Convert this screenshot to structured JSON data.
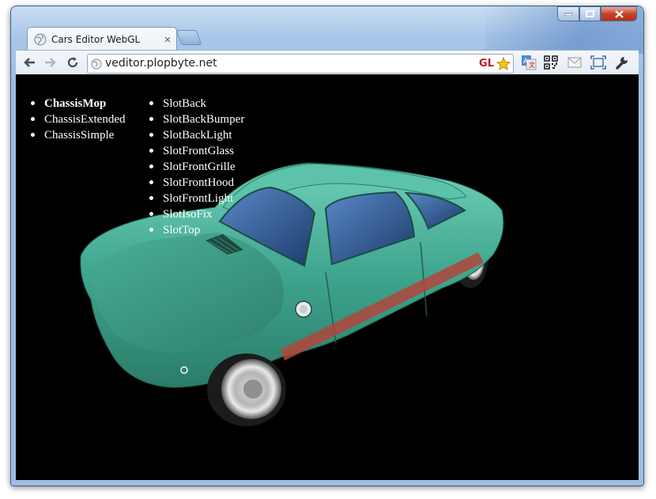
{
  "browser": {
    "tab_title": "Cars Editor WebGL",
    "url": "veditor.plopbyte.net",
    "gl_badge": "GL"
  },
  "chassis_list": [
    {
      "label": "ChassisMop",
      "selected": true
    },
    {
      "label": "ChassisExtended",
      "selected": false
    },
    {
      "label": "ChassisSimple",
      "selected": false
    }
  ],
  "slot_list": [
    {
      "label": "SlotBack"
    },
    {
      "label": "SlotBackBumper"
    },
    {
      "label": "SlotBackLight"
    },
    {
      "label": "SlotFrontGlass"
    },
    {
      "label": "SlotFrontGrille"
    },
    {
      "label": "SlotFrontHood"
    },
    {
      "label": "SlotFrontLight"
    },
    {
      "label": "SlotIsoFix"
    },
    {
      "label": "SlotTop"
    }
  ],
  "colors": {
    "car_body": "#3fa58e",
    "car_stripe": "#b2453b",
    "viewport_bg": "#000000"
  }
}
